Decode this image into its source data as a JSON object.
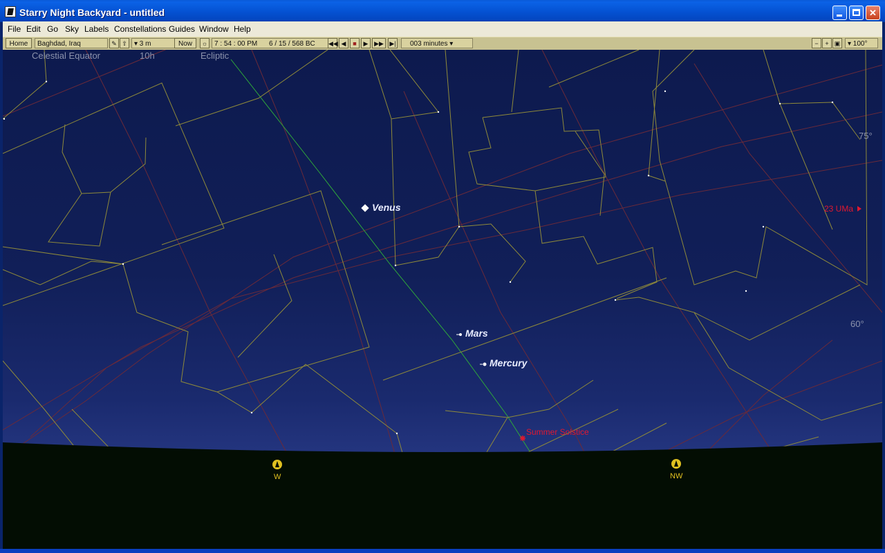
{
  "window": {
    "title": "Starry Night Backyard - untitled"
  },
  "menu": [
    "File",
    "Edit",
    "Go",
    "Sky",
    "Labels",
    "Constellations",
    "Guides",
    "Window",
    "Help"
  ],
  "toolbar": {
    "home": "Home",
    "location": "Baghdad, Iraq",
    "elevation": "▾ 3 m",
    "now": "Now",
    "time": "7 : 54 : 00 PM",
    "date": "6 / 15 /  568 BC",
    "timestep": "003 minutes ▾",
    "zoom": "▾ 100°"
  },
  "sky": {
    "grid_labels": {
      "celestial_equator": "Celestial Equator",
      "ra_10h": "10h",
      "ecliptic": "Ecliptic",
      "alt_75": "75°",
      "alt_60": "60°"
    },
    "planets": {
      "venus": "Venus",
      "mars": "Mars",
      "mercury": "Mercury"
    },
    "markers": {
      "summer_solstice": "Summer Solstice",
      "star_23uma": "23 UMa"
    },
    "compass": {
      "west": "W",
      "northwest": "NW"
    }
  },
  "colors": {
    "constellation_line": "#8f8a3a",
    "ecliptic_line": "#2fa83a",
    "grid_line": "#6a2a3a",
    "ground": "#030d03",
    "compass_label": "#e0c020",
    "red_label": "#e01830"
  }
}
